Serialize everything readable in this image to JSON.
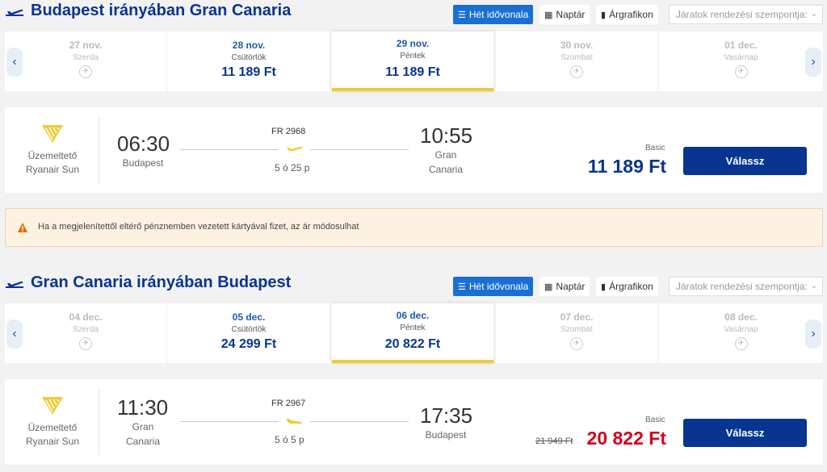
{
  "outbound": {
    "title": "Budapest irányában Gran Canaria",
    "views": {
      "week": "Hét idővonala",
      "calendar": "Naptár",
      "price_chart": "Árgrafikon"
    },
    "sort_placeholder": "Járatok rendezési szempontja:",
    "dates": [
      {
        "date": "27 nov.",
        "weekday": "Szerda",
        "price": ""
      },
      {
        "date": "28 nov.",
        "weekday": "Csütörtök",
        "price": "11 189 Ft"
      },
      {
        "date": "29 nov.",
        "weekday": "Péntek",
        "price": "11 189 Ft"
      },
      {
        "date": "30 nov.",
        "weekday": "Szombat",
        "price": ""
      },
      {
        "date": "01 dec.",
        "weekday": "Vasárnap",
        "price": ""
      }
    ],
    "flight": {
      "operator_line1": "Üzemeltető",
      "operator_line2": "Ryanair Sun",
      "dep_time": "06:30",
      "dep_city_1": "Budapest",
      "dep_city_2": "",
      "flight_no": "FR 2968",
      "duration": "5 ó 25 p",
      "arr_time": "10:55",
      "arr_city_1": "Gran",
      "arr_city_2": "Canaria",
      "fare_label": "Basic",
      "old_price": "",
      "price": "11 189 Ft",
      "select_label": "Válassz"
    }
  },
  "warning": {
    "text": "Ha a megjelenítettől eltérő pénznemben vezetett kártyával fizet, az ár módosulhat"
  },
  "inbound": {
    "title": "Gran Canaria irányában Budapest",
    "views": {
      "week": "Hét idővonala",
      "calendar": "Naptár",
      "price_chart": "Árgrafikon"
    },
    "sort_placeholder": "Járatok rendezési szempontja:",
    "dates": [
      {
        "date": "04 dec.",
        "weekday": "Szerda",
        "price": ""
      },
      {
        "date": "05 dec.",
        "weekday": "Csütörtök",
        "price": "24 299 Ft"
      },
      {
        "date": "06 dec.",
        "weekday": "Péntek",
        "price": "20 822 Ft"
      },
      {
        "date": "07 dec.",
        "weekday": "Szombat",
        "price": ""
      },
      {
        "date": "08 dec.",
        "weekday": "Vasárnap",
        "price": ""
      }
    ],
    "flight": {
      "operator_line1": "Üzemeltető",
      "operator_line2": "Ryanair Sun",
      "dep_time": "11:30",
      "dep_city_1": "Gran",
      "dep_city_2": "Canaria",
      "flight_no": "FR 2967",
      "duration": "5 ó 5 p",
      "arr_time": "17:35",
      "arr_city_1": "Budapest",
      "arr_city_2": "",
      "fare_label": "Basic",
      "old_price": "21 949 Ft",
      "price": "20 822 Ft",
      "select_label": "Válassz"
    }
  },
  "colors": {
    "brand_blue": "#073590",
    "accent_blue": "#1a6fd2",
    "selected_underline": "#f1c933",
    "sale_red": "#d0021b"
  },
  "icons": {
    "plane": "plane-takeoff-icon",
    "no_flight": "no-flight-icon",
    "warning": "warning-triangle-icon"
  }
}
